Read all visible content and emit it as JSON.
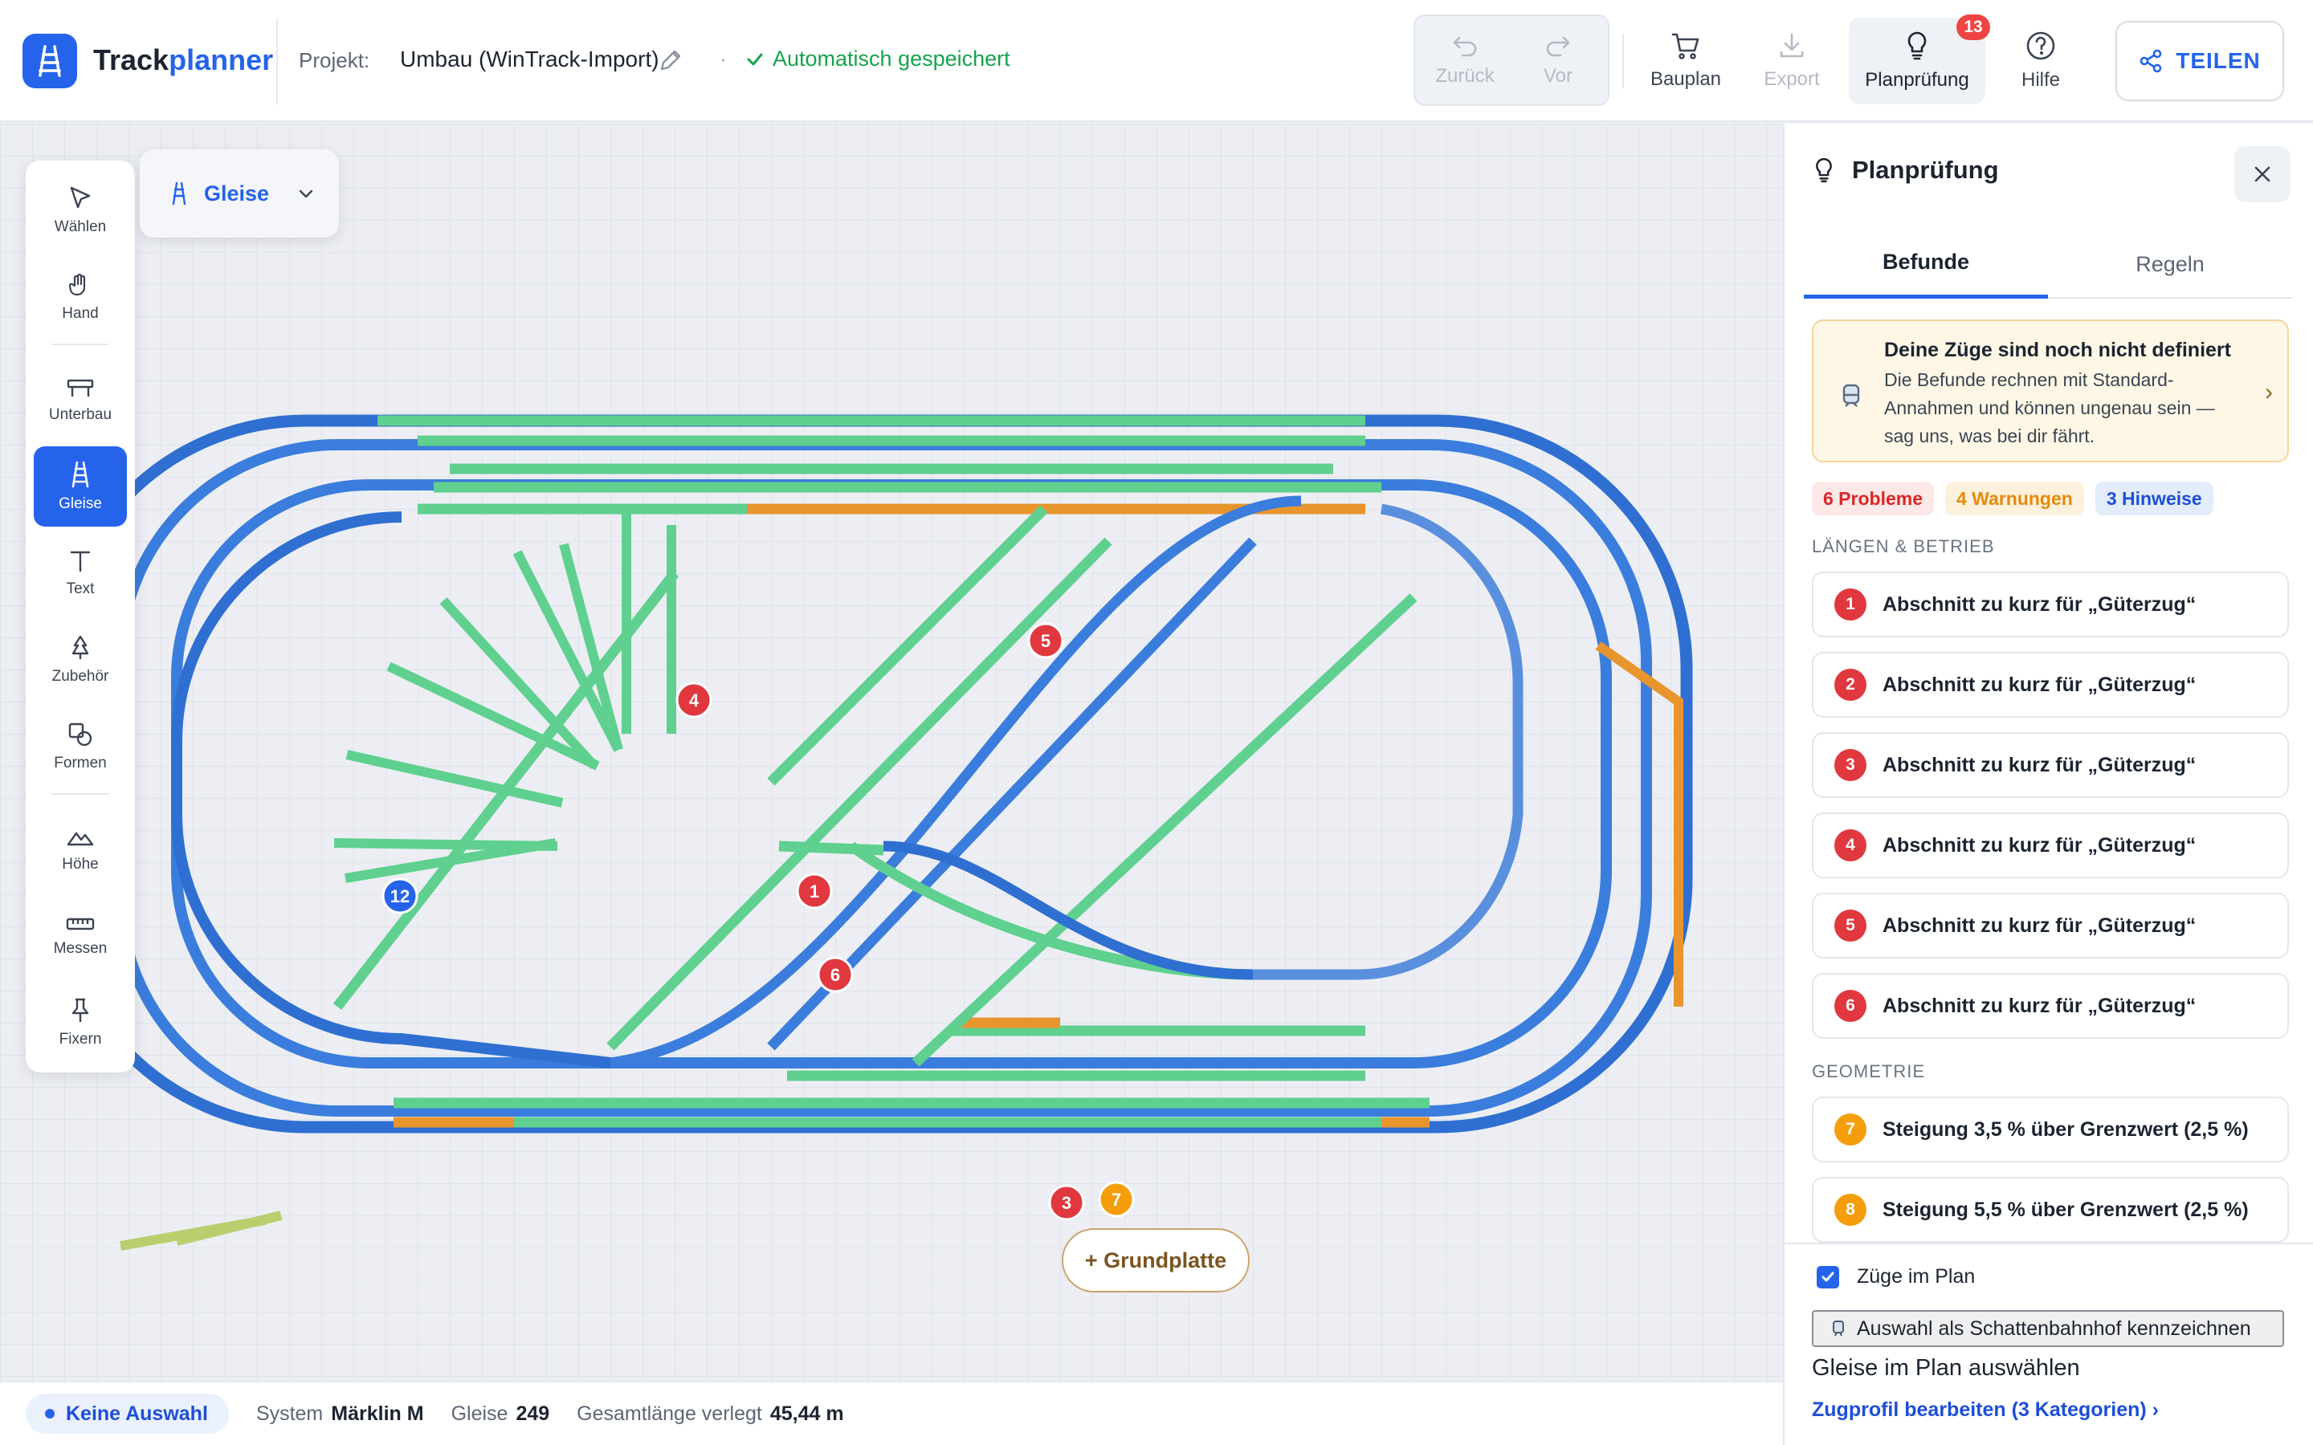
{
  "app": {
    "logo_prefix": "Track",
    "logo_suffix": "planner",
    "project_label": "Projekt:",
    "project_name": "Umbau (WinTrack-Import)",
    "separator": "·",
    "save_status": "Automatisch gespeichert",
    "accent_color": "#2563eb"
  },
  "toolbar": {
    "undo": "Zurück",
    "redo": "Vor",
    "bauplan": "Bauplan",
    "export": "Export",
    "planpruefung": "Planprüfung",
    "planpruefung_badge": "13",
    "hilfe": "Hilfe",
    "share": "TEILEN"
  },
  "tools": {
    "waehlen": "Wählen",
    "hand": "Hand",
    "unterbau": "Unterbau",
    "gleise": "Gleise",
    "text": "Text",
    "zubehoer": "Zubehör",
    "formen": "Formen",
    "hoehe": "Höhe",
    "messen": "Messen",
    "fixern": "Fixern",
    "active": "gleise"
  },
  "layer": {
    "selected": "Gleise"
  },
  "canvas": {
    "add_baseplate": "+ Grundplatte",
    "markers": [
      {
        "n": "1",
        "kind": "problem"
      },
      {
        "n": "3",
        "kind": "problem"
      },
      {
        "n": "4",
        "kind": "problem"
      },
      {
        "n": "5",
        "kind": "problem"
      },
      {
        "n": "6",
        "kind": "problem"
      },
      {
        "n": "7",
        "kind": "warning"
      },
      {
        "n": "12",
        "kind": "hint"
      }
    ],
    "track_colors": {
      "ok": "#5fd08f",
      "curve": "#3b7ddd",
      "warning": "#e8952e",
      "siding": "#b9cf6e"
    }
  },
  "status": {
    "selection": "Keine Auswahl",
    "system_label": "System",
    "system_value": "Märklin M",
    "tracks_label": "Gleise",
    "tracks_value": "249",
    "length_label": "Gesamtlänge verlegt",
    "length_value": "45,44 m"
  },
  "panel": {
    "title": "Planprüfung",
    "tabs": [
      "Befunde",
      "Regeln"
    ],
    "active_tab": "Befunde",
    "notice_title": "Deine Züge sind noch nicht definiert",
    "notice_text": "Die Befunde rechnen mit Standard-Annahmen und können ungenau sein — sag uns, was bei dir fährt.",
    "chips": {
      "problems": "6 Probleme",
      "warnings": "4 Warnungen",
      "hints": "3 Hinweise"
    },
    "section_lengths": "LÄNGEN & BETRIEB",
    "section_geometry": "GEOMETRIE",
    "findings": [
      {
        "n": "1",
        "text": "Abschnitt zu kurz für „Güterzug“",
        "severity": "problem"
      },
      {
        "n": "2",
        "text": "Abschnitt zu kurz für „Güterzug“",
        "severity": "problem"
      },
      {
        "n": "3",
        "text": "Abschnitt zu kurz für „Güterzug“",
        "severity": "problem"
      },
      {
        "n": "4",
        "text": "Abschnitt zu kurz für „Güterzug“",
        "severity": "problem"
      },
      {
        "n": "5",
        "text": "Abschnitt zu kurz für „Güterzug“",
        "severity": "problem"
      },
      {
        "n": "6",
        "text": "Abschnitt zu kurz für „Güterzug“",
        "severity": "problem"
      }
    ],
    "geometry_findings": [
      {
        "n": "7",
        "text": "Steigung 3,5 % über Grenzwert (2,5 %)",
        "severity": "warning"
      },
      {
        "n": "8",
        "text": "Steigung 5,5 % über Grenzwert (2,5 %)",
        "severity": "warning"
      }
    ],
    "trains_checkbox": "Züge im Plan",
    "shadow_button": "Auswahl als Schattenbahnhof kennzeichnen",
    "footer_hint": "Gleise im Plan auswählen",
    "footer_link": "Zugprofil bearbeiten (3 Kategorien) ›"
  }
}
